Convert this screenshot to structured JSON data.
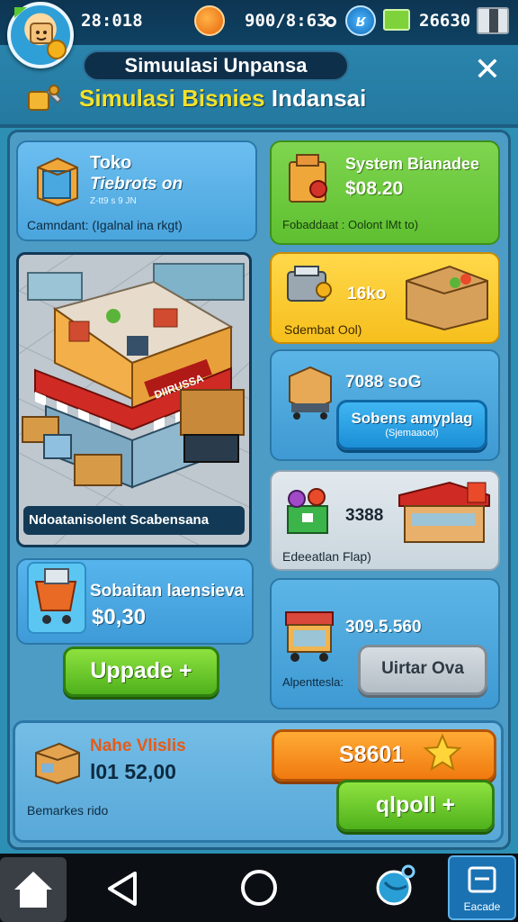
{
  "status_bar": {
    "time": "28:018",
    "middle": "900/8:63",
    "right": "26630"
  },
  "header": {
    "title": "Simuulasi Unpansa",
    "subtitle_highlight": "Simulasi Bisnies",
    "subtitle_rest": "Indansai"
  },
  "left": {
    "toko": {
      "title": "Toko",
      "subtitle": "Tiebrots on",
      "tiny": "Z-tt9 s 9 JN",
      "note": "Camndant: (Igalnal ina rkgt)"
    },
    "scene": {
      "sign": "DIIRUSSA",
      "caption": "Ndoatanisolent Scabensana"
    },
    "upgrade": {
      "title": "Sobaitan laensieva",
      "price": "$0,30",
      "button": "Uppade +"
    }
  },
  "right": {
    "system": {
      "title": "System Bianadee",
      "value": "$08.20",
      "note": "Fobaddaat : Oolont lMt to)"
    },
    "stock": {
      "title": "16ko",
      "note": "Sdembat Ool)"
    },
    "supply": {
      "value": "7088 soG",
      "button_line1": "Sobens amyplag",
      "button_line2": "(Sjemaaool)"
    },
    "market": {
      "value": "3388",
      "note": "Edeeatlan Flap)"
    },
    "delivery": {
      "value": "309.5.560",
      "note": "Alpenttesla:",
      "button": "Uirtar Ova"
    }
  },
  "bottom": {
    "title": "Nahe Vlislis",
    "value": "l01 52,00",
    "note": "Bemarkes rido",
    "coin_button": "S8601",
    "buy_button": "qlpoll +"
  },
  "nav": {
    "panel_label": "Eacade"
  },
  "colors": {
    "background": "#2d8fb4",
    "green_button": "#4fb11c",
    "orange_button": "#f07a0f",
    "blue_button": "#1c8fd6",
    "subtitle_yellow": "#f4e12b"
  },
  "icons": [
    "avatar",
    "orange-orb-icon",
    "blue-shield-icon",
    "battery-icon",
    "close-icon",
    "wrench-icon",
    "star-icon",
    "home-icon",
    "back-icon",
    "circle-home-icon",
    "globe-icon",
    "panel-icon"
  ]
}
